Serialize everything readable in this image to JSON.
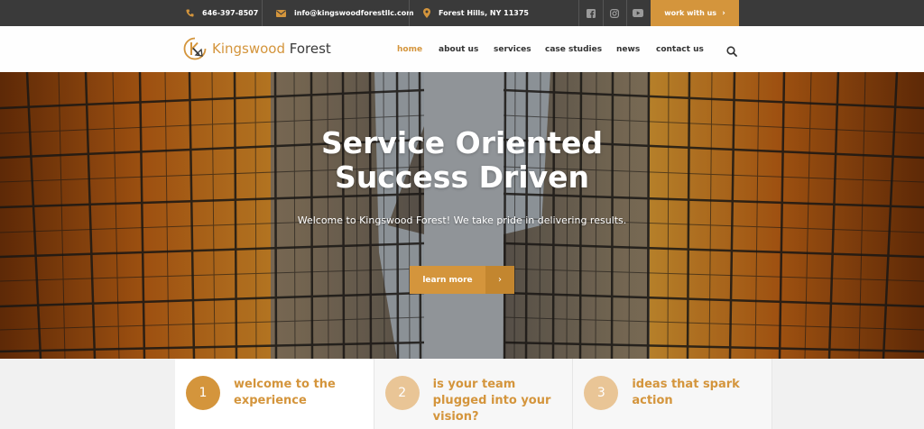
{
  "topbar": {
    "phone": "646-397-8507",
    "email": "info@kingswoodforestllc.com",
    "location": "Forest Hills, NY 11375",
    "social": [
      "facebook-icon",
      "instagram-icon",
      "youtube-icon"
    ],
    "cta_label": "work with us",
    "cta_arrow": "›"
  },
  "header": {
    "logo_brand": "Kingswood",
    "logo_rest": " Forest",
    "nav": [
      {
        "label": "home",
        "active": true
      },
      {
        "label": "about us",
        "active": false
      },
      {
        "label": "services",
        "active": false
      },
      {
        "label": "case studies",
        "active": false
      },
      {
        "label": "news",
        "active": false
      },
      {
        "label": "contact us",
        "active": false
      }
    ]
  },
  "hero": {
    "title_line1": "Service Oriented",
    "title_line2": "Success Driven",
    "subtitle": "Welcome to Kingswood Forest! We take pride in delivering results.",
    "button_label": "learn more",
    "button_arrow": "›"
  },
  "features": [
    {
      "number": "1",
      "text": "welcome to the experience",
      "circle_color": "#d4953c"
    },
    {
      "number": "2",
      "text": "is your team plugged into your vision?",
      "circle_color": "#e9c596"
    },
    {
      "number": "3",
      "text": "ideas that spark action",
      "circle_color": "#e9c596"
    }
  ],
  "colors": {
    "accent": "#d4953c",
    "topbar_bg": "#3a3a3a",
    "text_dark": "#333333"
  }
}
